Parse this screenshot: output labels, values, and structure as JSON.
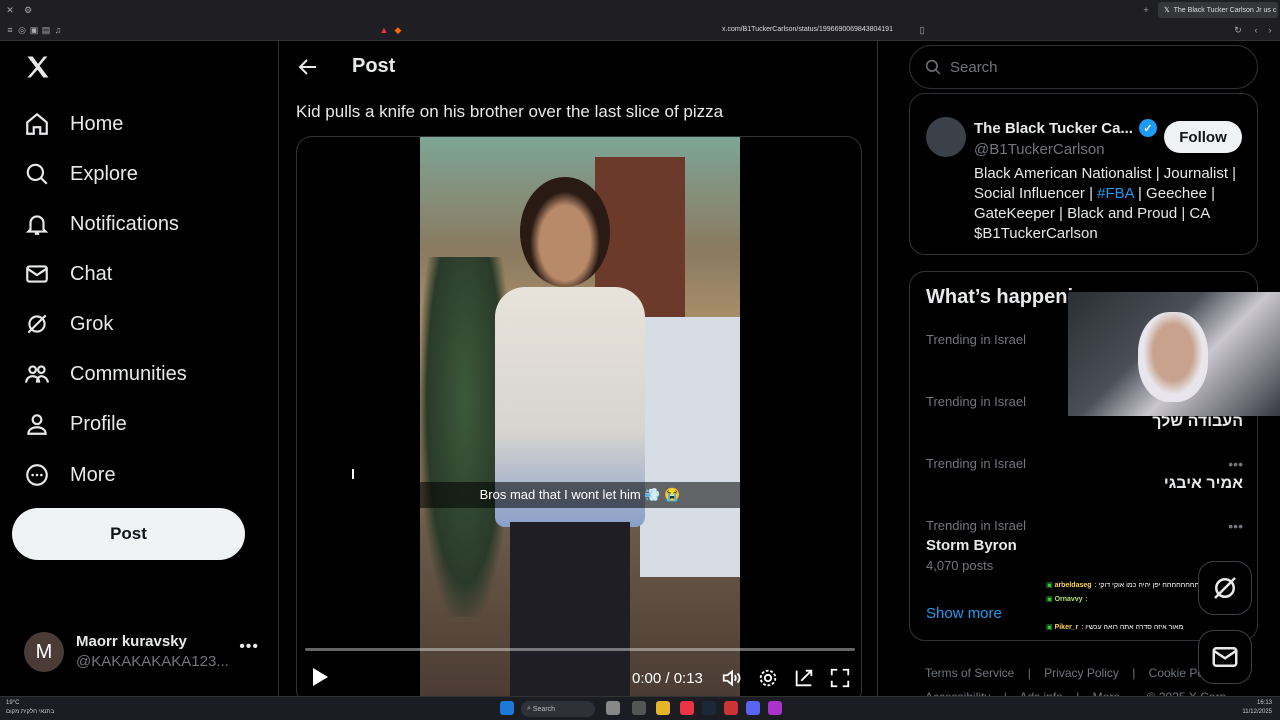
{
  "browser": {
    "tab_title": "The Black Tucker Carlson Jr us c",
    "url": "x.com/B1TuckerCarlson/status/1996690069843804191"
  },
  "nav": {
    "items": [
      {
        "label": "Home",
        "icon": "home-icon"
      },
      {
        "label": "Explore",
        "icon": "search-icon"
      },
      {
        "label": "Notifications",
        "icon": "bell-icon"
      },
      {
        "label": "Chat",
        "icon": "mail-icon"
      },
      {
        "label": "Grok",
        "icon": "grok-icon"
      },
      {
        "label": "Communities",
        "icon": "people-icon"
      },
      {
        "label": "Profile",
        "icon": "person-icon"
      },
      {
        "label": "More",
        "icon": "more-circle-icon"
      }
    ],
    "post_button": "Post",
    "account": {
      "avatar_letter": "M",
      "name": "Maorr kuravsky",
      "handle": "@KAKAKAKAKA123..."
    }
  },
  "main": {
    "header_title": "Post",
    "tweet_text": "Kid pulls a knife on his brother over the last slice of pizza",
    "video": {
      "caption": "Bros mad that I wont let him 💨 😭",
      "time": "0:00 / 0:13",
      "progress": 0
    }
  },
  "right": {
    "search_placeholder": "Search",
    "profile": {
      "name": "The Black Tucker Ca...",
      "handle": "@B1TuckerCarlson",
      "follow_label": "Follow",
      "bio_pre": "Black American Nationalist | Journalist | Social Influencer | ",
      "bio_tag": "#FBA",
      "bio_post": " | Geechee | GateKeeper | Black and Proud | CA $B1TuckerCarlson"
    },
    "trends_title": "What’s happening",
    "trends": [
      {
        "meta": "Trending in Israel",
        "name": "",
        "count": ""
      },
      {
        "meta": "Trending in Israel",
        "name": "העבודה שלך",
        "count": ""
      },
      {
        "meta": "Trending in Israel",
        "name": "אמיר איבגי",
        "count": ""
      },
      {
        "meta": "Trending in Israel",
        "name": "Storm Byron",
        "count": "4,070 posts"
      }
    ],
    "show_more": "Show more",
    "footer": [
      "Terms of Service",
      "|",
      "Privacy Policy",
      "|",
      "Cookie Policy",
      "Accessibility",
      "|",
      "Ads info",
      "|",
      "More ...",
      "© 2025 X Corp."
    ]
  },
  "overlay_chat": [
    {
      "user": "arbeldaseg",
      "msg": ": חחחחחחחח יפן יהיה כמו אוקי דוקי"
    },
    {
      "user": "Ornavvy",
      "msg": ":"
    },
    {
      "user": "Piker_r",
      "msg": ": מאור איזה סדרה אתה רואה עכשיו"
    }
  ],
  "taskbar": {
    "weather": "19°C",
    "weather_sub": "בתנאי חלקית מקום",
    "search": "Search",
    "time": "16:13",
    "date": "11/12/2025"
  },
  "colors": {
    "accent": "#1d9bf0",
    "bg": "#000000",
    "border": "#2f3336",
    "muted": "#71767b"
  }
}
